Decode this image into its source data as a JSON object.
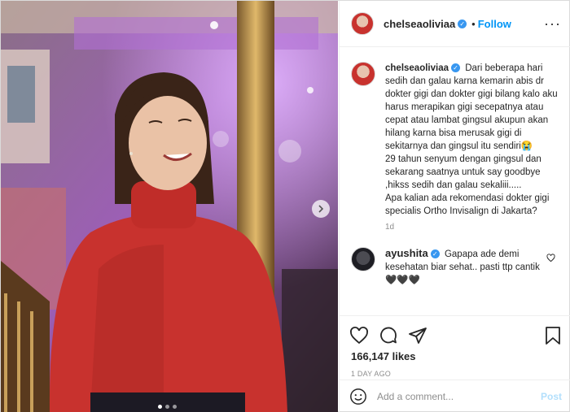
{
  "post": {
    "author": "chelseaoliviaa",
    "follow_label": "Follow",
    "separator": "•",
    "more_label": "···",
    "photo": {
      "next_icon": "chevron-right-icon",
      "carousel_dots": 3,
      "carousel_active_index": 0
    }
  },
  "caption": {
    "username": "chelseaoliviaa",
    "text": "Dari beberapa hari sedih dan galau karna kemarin abis dr dokter gigi dan dokter gigi bilang kalo aku harus merapikan gigi secepatnya atau cepat atau lambat gingsul akupun akan hilang karna bisa merusak gigi di sekitarnya dan gingsul itu sendiri😭\n29 tahun senyum dengan gingsul dan sekarang saatnya untuk say goodbye ,hikss sedih dan galau sekaliii.....\nApa kalian ada rekomendasi dokter gigi specialis Ortho Invisalign di Jakarta?",
    "time_ago": "1d"
  },
  "comment": {
    "username": "ayushita",
    "text": "Gapapa ade demi kesehatan biar sehat.. pasti ttp cantik 🖤🖤🖤"
  },
  "actions": {
    "likes": "166,147 likes",
    "date": "1 DAY AGO"
  },
  "add_comment": {
    "placeholder": "Add a comment...",
    "post_label": "Post"
  },
  "colors": {
    "accent": "#0095f6",
    "verified": "#3897f0",
    "muted": "#8e8e8e",
    "sweater": "#c8322e"
  }
}
